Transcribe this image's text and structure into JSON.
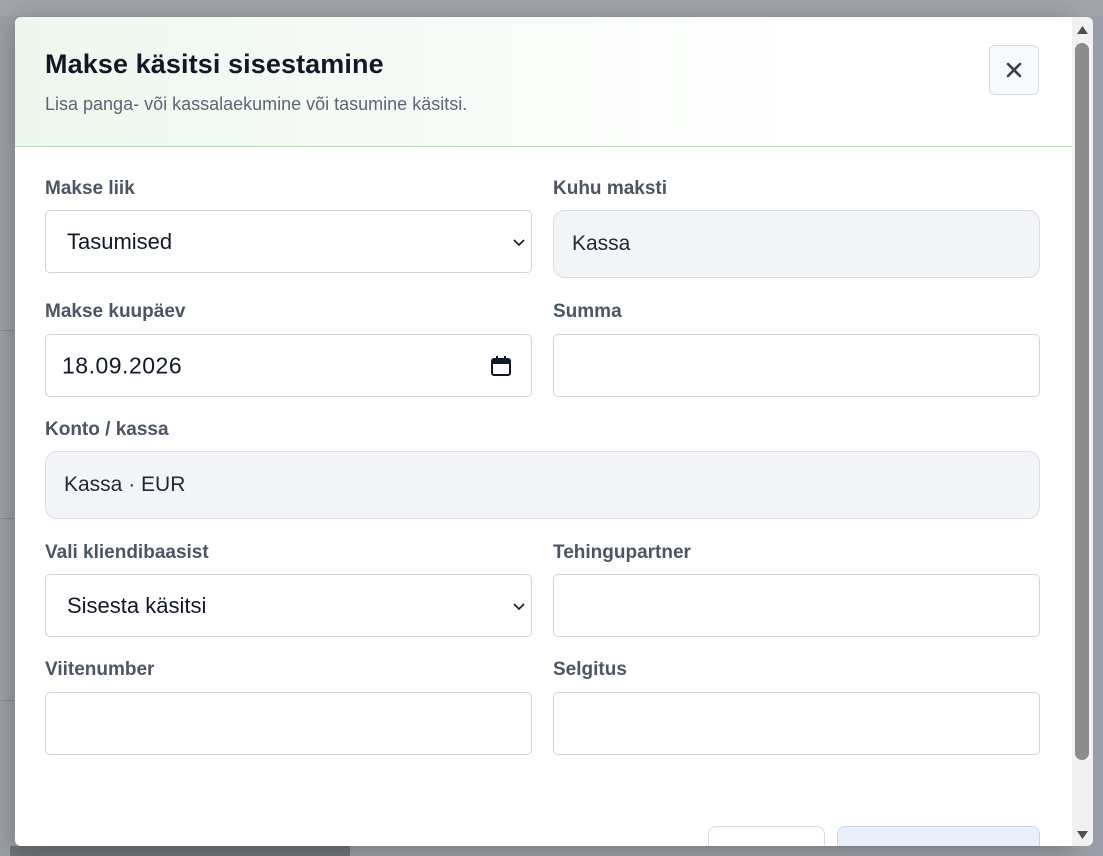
{
  "modal": {
    "title": "Makse käsitsi sisestamine",
    "subtitle": "Lisa panga- või kassalaekumine või tasumine käsitsi.",
    "close_icon": "close-icon"
  },
  "form": {
    "payment_type": {
      "label": "Makse liik",
      "value": "Tasumised"
    },
    "destination": {
      "label": "Kuhu maksti",
      "value": "Kassa"
    },
    "payment_date": {
      "label": "Makse kuupäev",
      "value": "18.09.2026"
    },
    "amount": {
      "label": "Summa",
      "value": ""
    },
    "account": {
      "label": "Konto / kassa",
      "value": "Kassa · EUR"
    },
    "client_select": {
      "label": "Vali kliendibaasist",
      "value": "Sisesta käsitsi"
    },
    "partner": {
      "label": "Tehingupartner",
      "value": ""
    },
    "reference": {
      "label": "Viitenumber",
      "value": ""
    },
    "description": {
      "label": "Selgitus",
      "value": ""
    }
  },
  "colors": {
    "header_tint": "#eef7ee",
    "header_border": "#b9d9b7",
    "readonly_bg": "#f3f5f8",
    "label": "#4b5563",
    "title": "#111827"
  }
}
